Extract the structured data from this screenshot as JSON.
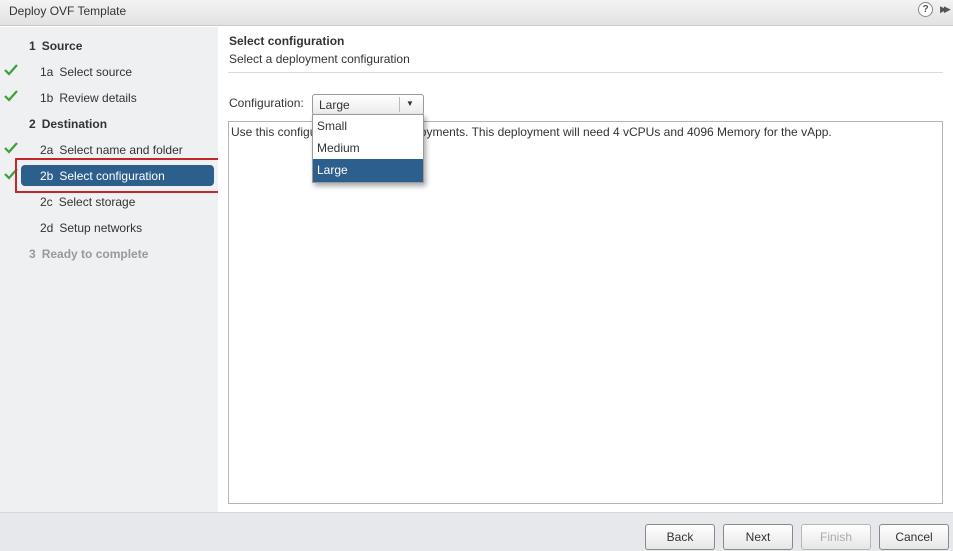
{
  "window": {
    "title": "Deploy OVF Template"
  },
  "nav": {
    "items": [
      {
        "num": "1",
        "label": "Source",
        "type": "section",
        "checked": false
      },
      {
        "num": "1a",
        "label": "Select source",
        "type": "sub",
        "checked": true
      },
      {
        "num": "1b",
        "label": "Review details",
        "type": "sub",
        "checked": true
      },
      {
        "num": "2",
        "label": "Destination",
        "type": "section",
        "checked": false
      },
      {
        "num": "2a",
        "label": "Select name and folder",
        "type": "sub",
        "checked": true
      },
      {
        "num": "2b",
        "label": "Select configuration",
        "type": "sub",
        "checked": true,
        "active": true
      },
      {
        "num": "2c",
        "label": "Select storage",
        "type": "sub",
        "checked": false
      },
      {
        "num": "2d",
        "label": "Setup networks",
        "type": "sub",
        "checked": false
      },
      {
        "num": "3",
        "label": "Ready to complete",
        "type": "section",
        "checked": false,
        "disabled": true
      }
    ]
  },
  "page": {
    "title": "Select configuration",
    "subtitle": "Select a deployment configuration"
  },
  "config": {
    "label": "Configuration:",
    "selected": "Large",
    "options": [
      "Small",
      "Medium",
      "Large"
    ],
    "description": "Use this configuration for large deployments. This deployment will need 4 vCPUs and 4096 Memory for the vApp."
  },
  "footer": {
    "back": "Back",
    "next": "Next",
    "finish": "Finish",
    "cancel": "Cancel"
  },
  "colors": {
    "accent": "#2d5f8c",
    "check": "#3aa13a",
    "highlight": "#c1272d"
  }
}
